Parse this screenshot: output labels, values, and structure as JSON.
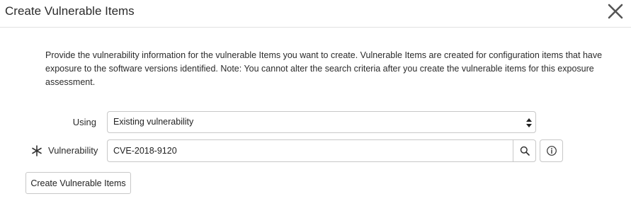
{
  "dialog": {
    "title": "Create Vulnerable Items",
    "close_icon": "close-icon"
  },
  "info": {
    "text": "Provide the vulnerability information for the vulnerable Items you want to create. Vulnerable Items are created for configuration items that have exposure to the software versions identified. Note: You cannot alter the search criteria after you create the vulnerable items for this exposure assessment."
  },
  "form": {
    "using": {
      "label": "Using",
      "value": "Existing vulnerability",
      "icon": "select-arrows-icon"
    },
    "vulnerability": {
      "label": "Vulnerability",
      "required_icon": "asterisk-icon",
      "value": "CVE-2018-9120",
      "lookup_icon": "search-icon",
      "info_icon": "info-icon"
    }
  },
  "actions": {
    "create_label": "Create Vulnerable Items"
  },
  "colors": {
    "border": "#c8c8c8",
    "text": "#2b2b2b",
    "divider": "#e2e2e2"
  }
}
